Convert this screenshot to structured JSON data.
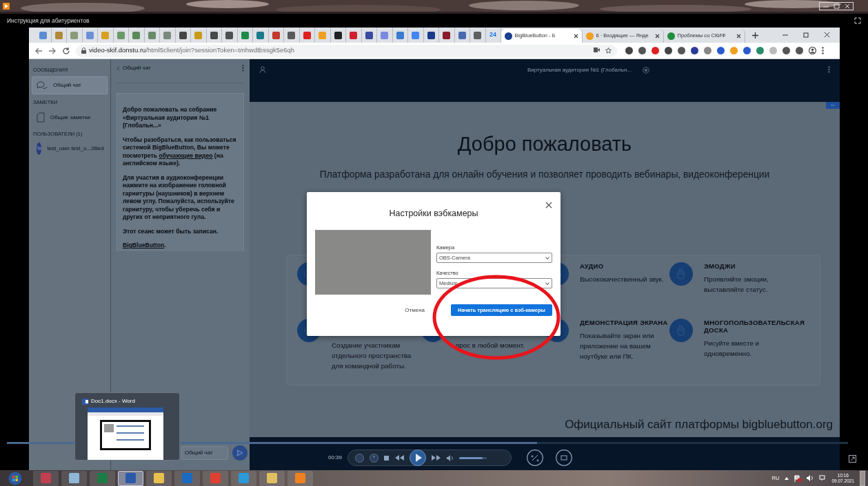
{
  "player": {
    "title": "Инструкция для абитуриентов",
    "time": "00:39",
    "progress": {
      "level": 0.63
    },
    "volume": {
      "level": 0.85
    }
  },
  "browser": {
    "pinned_tabs": [
      {
        "color": "#5b8dd6"
      },
      {
        "color": "#b08a3a"
      },
      {
        "color": "#8a9a7a"
      },
      {
        "color": "#6d8fd8"
      },
      {
        "color": "#d8a020"
      },
      {
        "color": "#6a9a6a"
      },
      {
        "color": "#5a8a5a"
      },
      {
        "color": "#6a8a6a"
      },
      {
        "color": "#7a8a7a"
      },
      {
        "color": "#444444"
      },
      {
        "color": "#c99a1a"
      },
      {
        "color": "#4a4a4a"
      },
      {
        "color": "#505050"
      },
      {
        "color": "#1e8a4a"
      },
      {
        "color": "#1a7a8a"
      },
      {
        "color": "#c0392b"
      },
      {
        "color": "#5a5a5a"
      },
      {
        "color": "#e02020"
      },
      {
        "color": "#f0a020"
      },
      {
        "color": "#222222"
      },
      {
        "color": "#d02030"
      },
      {
        "color": "#3a4aa0"
      },
      {
        "color": "#7a8ae0"
      },
      {
        "color": "#3a7ad0"
      },
      {
        "color": "#4285f4"
      },
      {
        "color": "#1a3a8a"
      },
      {
        "color": "#8a1a2a"
      },
      {
        "color": "#4a6ab0"
      },
      {
        "color": "#606060"
      }
    ],
    "tabs": [
      {
        "kind": "pinned",
        "label": "24",
        "selected": false
      },
      {
        "kind": "page",
        "label": "BigBlueButton - Б",
        "color": "#1a3f8f",
        "selected": true
      },
      {
        "kind": "page",
        "label": "6 · Входящие — Янде",
        "color": "#f0a020",
        "selected": false
      },
      {
        "kind": "page",
        "label": "Проблемы со СКИФ",
        "color": "#1e8e3e",
        "selected": false
      }
    ],
    "url": {
      "host": "video-skif.donstu.ru",
      "path": "/html5client/join?sessionToken=tmhwdtbssgk5e6qh"
    },
    "extensions": [
      {
        "color": "#444444"
      },
      {
        "color": "#555555"
      },
      {
        "color": "#e02020"
      },
      {
        "color": "#444444"
      },
      {
        "color": "#555555"
      },
      {
        "color": "#2a3a9a"
      },
      {
        "color": "#888888"
      },
      {
        "color": "#2a5ad0"
      },
      {
        "color": "#f0a020"
      },
      {
        "color": "#2a5ad0"
      },
      {
        "color": "#2a8a6a"
      },
      {
        "color": "#bbbbbb"
      },
      {
        "color": "#555555"
      },
      {
        "color": "#555555"
      }
    ]
  },
  "sidebar": {
    "sections": [
      {
        "title": "СООБЩЕНИЯ",
        "items": [
          {
            "kind": "chat",
            "label": "Общий чат",
            "selected": true
          }
        ]
      },
      {
        "title": "ЗАМЕТКИ",
        "items": [
          {
            "kind": "notes",
            "label": "Общие заметки",
            "selected": false
          }
        ]
      },
      {
        "title": "ПОЛЬЗОВАТЕЛИ (1)",
        "items": [
          {
            "kind": "user",
            "avatar": "Te",
            "label": "test_user test_u...2Bed",
            "selected": false
          }
        ]
      }
    ]
  },
  "chat": {
    "back_label": "Общий чат",
    "messages": [
      {
        "text": "Добро пожаловать на собрание **«Виртуальная аудитория №1 (Глобальн...»**"
      },
      {
        "text": "Чтобы разобраться, как пользоваться системой BigBlueButton, Вы можете посмотреть",
        "link": "обучающие видео",
        "after": " (на английском языке)."
      },
      {
        "text": "Для участия в аудиоконференции нажмите на изображение головной гарнитуры (наушников) в верхнем левом углу. **Пожалуйста, используйте гарнитуру, чтобы уберечь себя и других от неприятного гула.**"
      },
      {
        "text": "Этот сеанс может быть записан."
      },
      {
        "link": "BigBlueButton",
        "after": "."
      }
    ],
    "input_placeholder": "Общий чат"
  },
  "main": {
    "header_title": "Виртуальная аудитория №1 (Глобальн...",
    "heading": "Добро пожаловать",
    "subtitle": "Платформа разработана для онлайн обучения и позволяет проводить вебинары, видеоконференции",
    "feature_rows": [
      [
        {},
        null,
        {
          "title": "АУДИО",
          "description": "Высококачественный звук."
        },
        {
          "title": "ЭМОДЖИ",
          "description": "Проявляйте эмоции, выставляйте статус."
        }
      ],
      [
        {
          "description": "Создание участникам отдельного пространства для командной работы."
        },
        {
          "description": "прос в любой момент."
        },
        {
          "title": "ДЕМОНСТРАЦИЯ ЭКРАНА",
          "description": "Показывайте экран или приложение на вашем ноутбуке или ПК."
        },
        {
          "title": "МНОГОПОЛЬЗОВАТЕЛЬСКАЯ ДОСКА",
          "description": "Рисуйте вместе и одновременно."
        }
      ]
    ],
    "footer_text": "Официальный сайт платформы",
    "footer_link": "bigbluebutton.org"
  },
  "modal": {
    "title": "Настройки вэбкамеры",
    "camera_label": "Камера",
    "camera_value": "OBS-Camera",
    "quality_label": "Качество",
    "quality_value": "Medium",
    "cancel": "Отмена",
    "start": "Начать трансляцию с вэб-камеры"
  },
  "thumbnail": {
    "title": "Doc1.docx - Word"
  },
  "taskbar": {
    "apps": [
      {
        "color": "#c04050",
        "selected": false
      },
      {
        "color": "#8fb8d8",
        "selected": false
      },
      {
        "color": "#1e7a45",
        "selected": false
      },
      {
        "color": "#2b5aa8",
        "selected": true
      },
      {
        "color": "#e8c050",
        "selected": false
      },
      {
        "color": "#1a6ac0",
        "selected": false
      },
      {
        "color": "#e04030",
        "selected": false
      },
      {
        "color": "#2a9ad8",
        "selected": false
      },
      {
        "color": "#e0c060",
        "selected": false
      },
      {
        "color": "#f08020",
        "selected": false
      }
    ],
    "language": "RU",
    "time": "10:16",
    "date": "09.07.2021"
  }
}
